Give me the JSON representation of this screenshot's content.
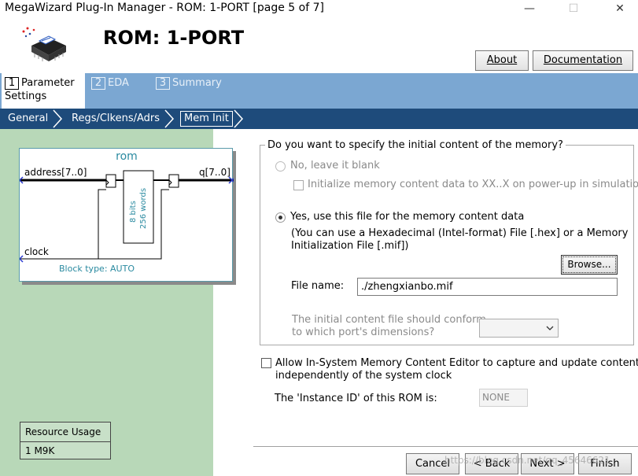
{
  "window": {
    "title": "MegaWizard Plug-In Manager - ROM: 1-PORT [page 5 of 7]",
    "minimize": "—",
    "maximize": "☐",
    "close": "✕"
  },
  "header": {
    "title": "ROM: 1-PORT",
    "about_label": "About",
    "documentation_label": "Documentation"
  },
  "steps": [
    {
      "num": "1",
      "label": "Parameter Settings"
    },
    {
      "num": "2",
      "label": "EDA"
    },
    {
      "num": "3",
      "label": "Summary"
    }
  ],
  "crumbs": [
    "General",
    "Regs/Clkens/Adrs",
    "Mem Init"
  ],
  "block": {
    "name": "rom",
    "address_pin": "address[7..0]",
    "q_pin": "q[7..0]",
    "clock_pin": "clock",
    "bits": "8 bits",
    "words": "256 words",
    "block_type": "Block type: AUTO"
  },
  "resource": {
    "heading": "Resource Usage",
    "value": "1 M9K"
  },
  "mem_init": {
    "question": "Do you want to specify the initial content of the memory?",
    "option_no": "No, leave it blank",
    "init_xx": "Initialize memory content data to XX..X on power-up in simulation",
    "option_yes": "Yes, use this file for the memory content data",
    "hint_line1": "(You can use a Hexadecimal (Intel-format) File [.hex] or a Memory",
    "hint_line2": "Initialization File [.mif])",
    "browse_label": "Browse...",
    "file_label": "File name:",
    "file_value": "./zhengxianbo.mif",
    "conform_line1": "The initial content file should conform",
    "conform_line2": "to which port's dimensions?",
    "selected_option": "yes"
  },
  "in_system": {
    "line1": "Allow In-System Memory Content Editor to capture and update content",
    "line2": "independently of the system clock",
    "instance_label": "The 'Instance ID' of this ROM is:",
    "instance_value": "NONE"
  },
  "footer": {
    "cancel": "Cancel",
    "back": "< Back",
    "next": "Next >",
    "finish": "Finish"
  },
  "watermark": "https://blog.csdn.net/qq_45646621",
  "colors": {
    "step_band": "#7ba7d2",
    "crumb_band": "#1e4b7b",
    "left_panel": "#b8d8b8",
    "block_title": "#2a8aa0"
  }
}
